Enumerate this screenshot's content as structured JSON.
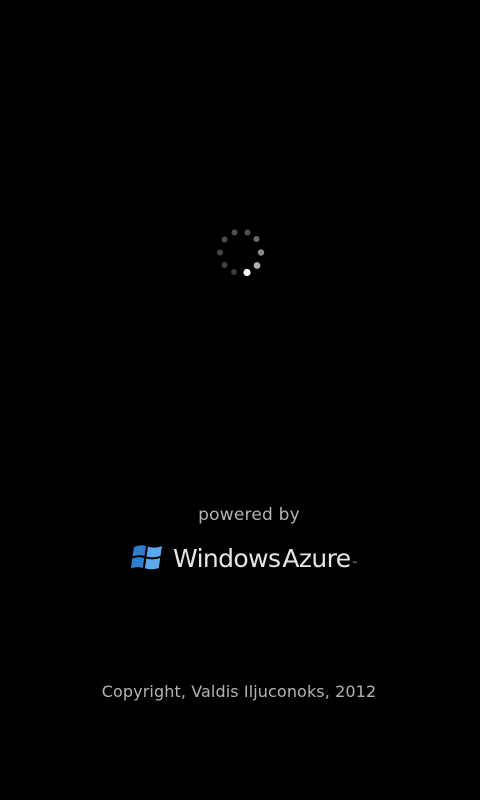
{
  "splash": {
    "loading_indicator": "spinner-icon",
    "powered_by": "powered by",
    "logo": {
      "icon": "windows-flag-icon",
      "brand_first": "Windows",
      "brand_second": "Azure",
      "trademark": "™",
      "colors": {
        "flag_blue": "#2f7fd0",
        "flag_light": "#5aa9ec",
        "text": "#e6e6e6"
      }
    },
    "copyright": "Copyright, Valdis Iljuconoks, 2012"
  },
  "colors": {
    "background": "#000000",
    "secondary_text": "#b4b4b4"
  }
}
